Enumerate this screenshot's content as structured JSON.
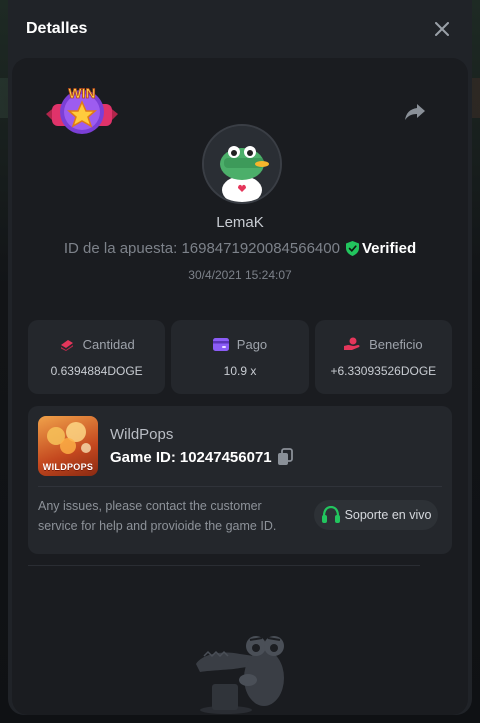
{
  "header": {
    "title": "Detalles"
  },
  "badge": {
    "text": "WIN"
  },
  "player": {
    "username": "LemaK"
  },
  "bet": {
    "id_label": "ID de la apuesta:",
    "id_value": "1698471920084566400",
    "verified_label": "Verified",
    "timestamp": "30/4/2021 15:24:07"
  },
  "stats": [
    {
      "label": "Cantidad",
      "value": "0.6394884DOGE",
      "icon": "coins-icon"
    },
    {
      "label": "Pago",
      "value": "10.9 x",
      "icon": "wallet-icon"
    },
    {
      "label": "Beneficio",
      "value": "+6.33093526DOGE",
      "icon": "profit-hand-icon"
    }
  ],
  "game": {
    "name": "WildPops",
    "thumb_label": "WILDPOPS",
    "id_label": "Game ID:",
    "id_value": "10247456071"
  },
  "support": {
    "message": "Any issues, please contact the customer service for help and provioide the game ID.",
    "button_label": "Soporte en vivo"
  },
  "colors": {
    "accent_red": "#e5365b",
    "accent_purple": "#8b5cf6",
    "verified_green": "#22c55e"
  }
}
